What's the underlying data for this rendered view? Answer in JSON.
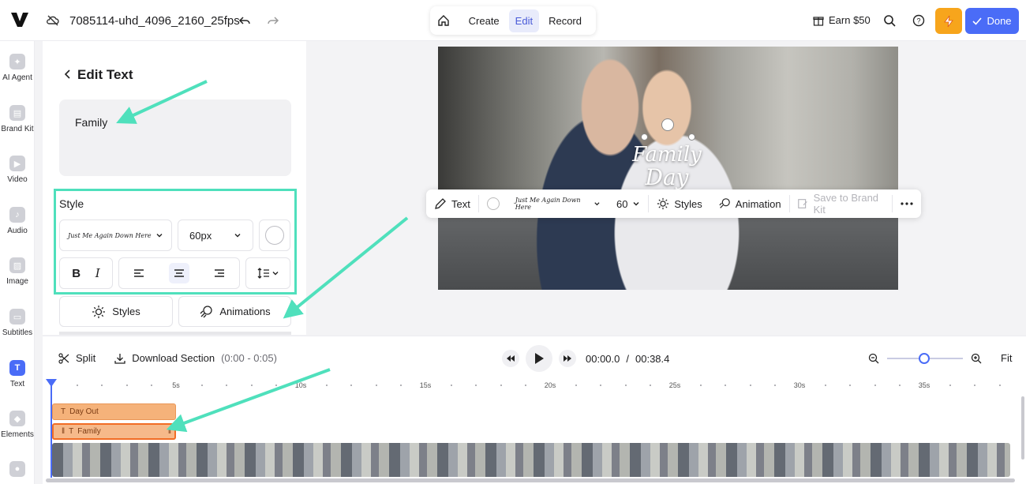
{
  "topbar": {
    "filename": "7085114-uhd_4096_2160_25fps",
    "modes": [
      "Create",
      "Edit",
      "Record"
    ],
    "active_mode": "Edit",
    "earn_label": "Earn $50",
    "done_label": "Done"
  },
  "rail": {
    "items": [
      {
        "label": "AI Agent",
        "icon": "sparkle-icon"
      },
      {
        "label": "Brand Kit",
        "icon": "brand-kit-icon"
      },
      {
        "label": "Video",
        "icon": "video-icon"
      },
      {
        "label": "Audio",
        "icon": "audio-icon"
      },
      {
        "label": "Image",
        "icon": "image-icon"
      },
      {
        "label": "Subtitles",
        "icon": "subtitles-icon"
      },
      {
        "label": "Text",
        "icon": "text-icon"
      },
      {
        "label": "Elements",
        "icon": "elements-icon"
      }
    ],
    "active": "Text"
  },
  "panel": {
    "title": "Edit Text",
    "text_value": "Family",
    "style_label": "Style",
    "font_name": "Just Me Again Down Here",
    "font_size": "60px",
    "styles_label": "Styles",
    "animations_label": "Animations"
  },
  "canvas": {
    "overlay_line1": "Family",
    "overlay_line2": "Day Out"
  },
  "text_toolbar": {
    "text_label": "Text",
    "font_name": "Just Me Again Down Here",
    "size": "60",
    "styles_label": "Styles",
    "animation_label": "Animation",
    "save_brand_label": "Save to Brand Kit"
  },
  "timeline": {
    "split_label": "Split",
    "download_label": "Download Section",
    "download_range": "(0:00 - 0:05)",
    "current_time": "00:00.0",
    "separator": "/",
    "total_time": "00:38.4",
    "fit_label": "Fit",
    "ruler_labels": [
      "5s",
      "10s",
      "15s",
      "20s",
      "25s",
      "30s",
      "35s"
    ],
    "clips": [
      {
        "label": "Day Out"
      },
      {
        "label": "Family"
      }
    ]
  },
  "colors": {
    "accent": "#4a6cf7",
    "highlight": "#4fe0bc",
    "clip": "#f5b27a",
    "bolt": "#f7a51c"
  }
}
